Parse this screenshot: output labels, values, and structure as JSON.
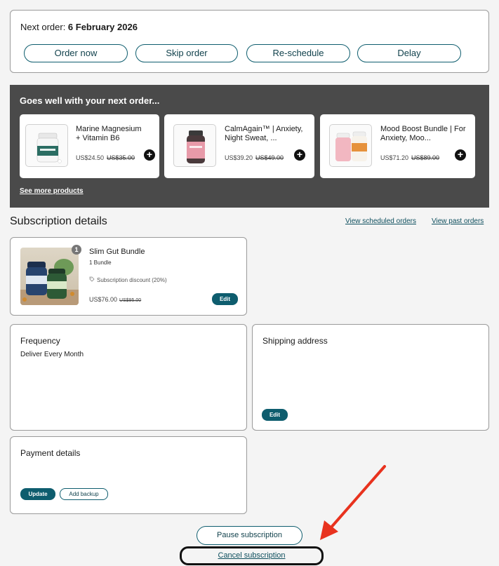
{
  "next_order": {
    "label": "Next order: ",
    "date": "6 February 2026",
    "actions": [
      "Order now",
      "Skip order",
      "Re-schedule",
      "Delay"
    ]
  },
  "upsell": {
    "title": "Goes well with your next order...",
    "products": [
      {
        "name_line1": "Marine Magnesium",
        "name_line2": "+ Vitamin B6",
        "price": "US$24.50",
        "compare_price": "US$35.00",
        "icon": "plus-icon"
      },
      {
        "name_line1": "CalmAgain™ | Anxiety,",
        "name_line2": "Night Sweat, ...",
        "price": "US$39.20",
        "compare_price": "US$49.00",
        "icon": "plus-icon"
      },
      {
        "name_line1": "Mood Boost Bundle | For",
        "name_line2": "Anxiety, Moo...",
        "price": "US$71.20",
        "compare_price": "US$89.00",
        "icon": "plus-icon"
      }
    ],
    "see_more": "See more products"
  },
  "subscription": {
    "title": "Subscription details",
    "view_scheduled": "View scheduled orders",
    "view_past": "View past orders",
    "item": {
      "quantity_badge": "1",
      "name": "Slim Gut Bundle",
      "quantity": "1 Bundle",
      "discount": "Subscription discount (20%)",
      "price": "US$76.00",
      "compare_price": "US$95.00",
      "edit_label": "Edit"
    }
  },
  "frequency": {
    "title": "Frequency",
    "value": "Deliver Every Month"
  },
  "shipping": {
    "title": "Shipping address",
    "edit_label": "Edit"
  },
  "payment": {
    "title": "Payment details",
    "update_label": "Update",
    "add_backup_label": "Add backup"
  },
  "actions": {
    "pause_label": "Pause subscription",
    "cancel_label": "Cancel subscription"
  },
  "colors": {
    "accent": "#0e5d6e",
    "band": "#4a4a4a",
    "annotation_arrow": "#e8321e"
  }
}
